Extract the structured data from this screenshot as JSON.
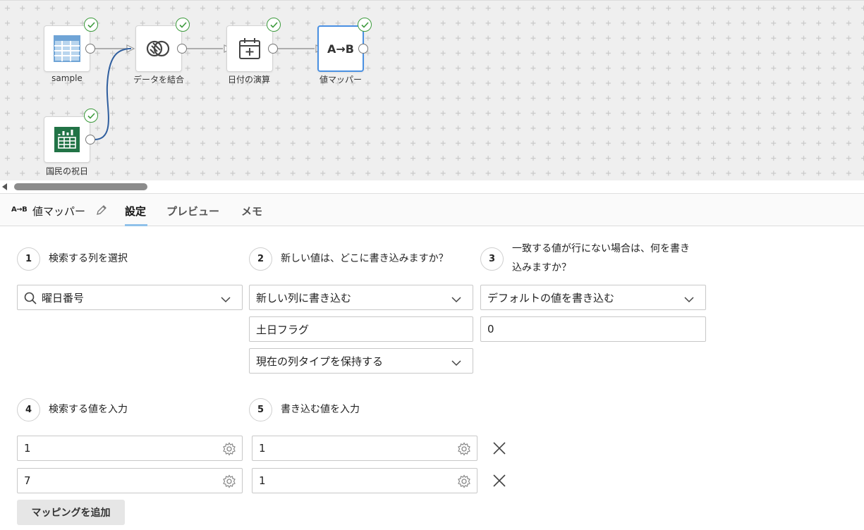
{
  "canvas": {
    "nodes": [
      {
        "id": "sample",
        "label": "sample",
        "icon": "table-icon"
      },
      {
        "id": "join",
        "label": "データを結合",
        "icon": "join-icon"
      },
      {
        "id": "date",
        "label": "日付の演算",
        "icon": "calendar-icon"
      },
      {
        "id": "mapper",
        "label": "値マッパー",
        "icon": "ab-mapper-icon",
        "icon_text": "A→B"
      },
      {
        "id": "holiday",
        "label": "国民の祝日",
        "icon": "excel-icon"
      }
    ]
  },
  "panel": {
    "icon_text": "A→B",
    "title": "値マッパー",
    "tabs": [
      "設定",
      "プレビュー",
      "メモ"
    ],
    "active_tab": "設定"
  },
  "steps": {
    "s1": {
      "num": "1",
      "label": "検索する列を選択",
      "value": "曜日番号"
    },
    "s2": {
      "num": "2",
      "label": "新しい値は、どこに書き込みますか？",
      "mode": "新しい列に書き込む",
      "column_name": "土日フラグ",
      "type_mode": "現在の列タイプを保持する"
    },
    "s3": {
      "num": "3",
      "label_line1": "一致する値が行にない場合は、何を書き",
      "label_line2": "込みますか？",
      "mode": "デフォルトの値を書き込む",
      "default_value": "0"
    },
    "s4": {
      "num": "4",
      "label": "検索する値を入力"
    },
    "s5": {
      "num": "5",
      "label": "書き込む値を入力"
    }
  },
  "mappings": [
    {
      "search": "1",
      "write": "1"
    },
    {
      "search": "7",
      "write": "1"
    }
  ],
  "add_mapping_label": "マッピングを追加",
  "colors": {
    "accent": "#4a90e2",
    "check": "#3c9a3c",
    "excel": "#217346",
    "table": "#9cc3e6"
  }
}
